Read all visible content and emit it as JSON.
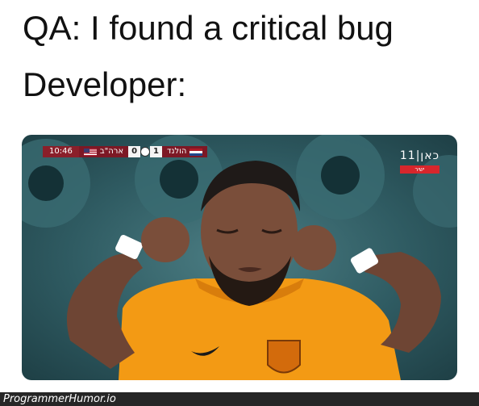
{
  "caption": {
    "line1": "QA: I found a critical bug",
    "line2": "Developer:"
  },
  "photo": {
    "scorebar": {
      "time": "10:46",
      "team_left": "ארה\"ב",
      "score_left": "0",
      "score_right": "1",
      "team_right": "הולנד",
      "icon": "soccer-ball-icon"
    },
    "channel": {
      "logo": "כאן|11",
      "tag": "ישיר"
    },
    "colors": {
      "background": "#2f5b62",
      "jersey": "#f39a14",
      "skin": "#7a4e3a",
      "armband": "#ffffff"
    }
  },
  "footer": {
    "watermark": "ProgrammerHumor.io"
  }
}
